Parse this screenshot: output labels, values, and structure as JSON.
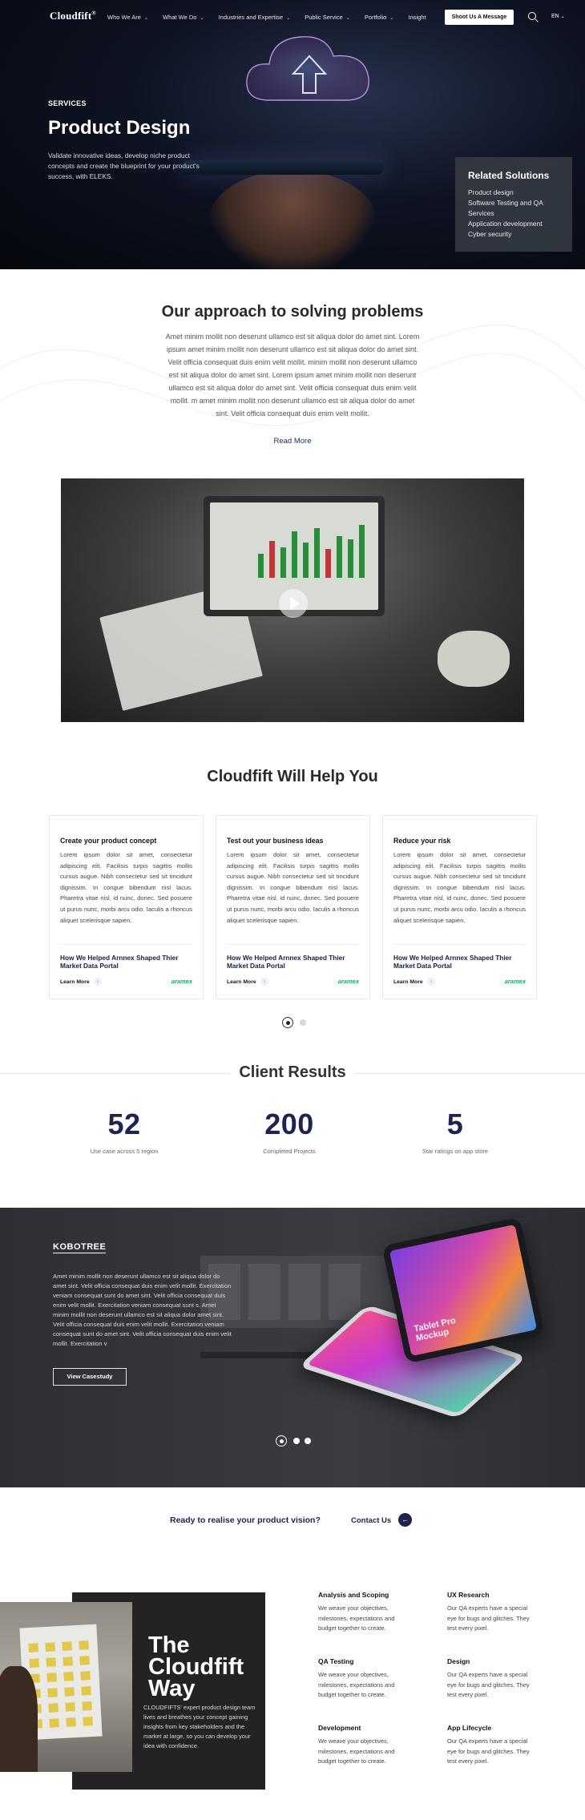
{
  "nav": {
    "logo": "Cloudfift",
    "logo_mark": "®",
    "items": [
      "Who We Are",
      "What We Do",
      "Industries and Expertise",
      "Public Service",
      "Portfolio",
      "Insight"
    ],
    "cta": "Shoot Us A Message",
    "lang": "EN",
    "icons": [
      "chevron-down-icon",
      "search-icon"
    ]
  },
  "hero": {
    "eyebrow": "SERVICES",
    "title": "Product Design",
    "description": "Validate innovative ideas, develop niche product concepts and create the blueprint for your product's success, with ELEKS.",
    "related_title": "Related Solutions",
    "related_items": [
      "Product design",
      "Software Testing and QA Services",
      "Application development",
      "Cyber security"
    ]
  },
  "approach": {
    "title": "Our approach to solving problems",
    "text": "Amet minim mollit non deserunt ullamco est sit aliqua dolor do amet sint. Lorem ipsum amet minim mollit non deserunt ullamco est sit aliqua dolor do amet sint. Velit officia consequat duis enim velit mollit. minim mollit non deserunt ullamco est sit aliqua dolor do amet sint. Lorem ipsum amet minim mollit non deserunt ullamco est sit aliqua dolor do amet sint. Velit officia consequat duis enim velit mollit. m amet minim mollit non deserunt ullamco est sit aliqua dolor do amet sint. Velit officia consequat duis enim velit mollit.",
    "read_more": "Read More"
  },
  "video": {
    "icon": "play-icon"
  },
  "help": {
    "title": "Cloudfift Will Help You",
    "cards": [
      {
        "title": "Create your product concept",
        "text": "Lorem ipsum dolor sit amet, consectetur adipiscing elit. Facilisis turpis sagittis mollis cursus augue. Nibh consectetur sed sit tincidunt dignissim. In congue bibendum nisl lacus. Pharetra vitae nisl, id nunc, donec. Sed posuere ut purus nunc, morbi arcu odio. Iaculis a rhoncus aliquet scelerisque sapien.",
        "case": "How We Helped Arnnex Shaped Thier Market Data Portal",
        "more": "Learn More",
        "brand": "aramex"
      },
      {
        "title": "Test out your business ideas",
        "text": "Lorem ipsum dolor sit amet, consectetur adipiscing elit. Facilisis turpis sagittis mollis cursus augue. Nibh consectetur sed sit tincidunt dignissim. In congue bibendum nisl lacus. Pharetra vitae nisl, id nunc, donec. Sed posuere ut purus nunc, morbi arcu odio. Iaculis a rhoncus aliquet scelerisque sapien.",
        "case": "How We Helped Arnnex Shaped Thier Market Data Portal",
        "more": "Learn More",
        "brand": "aramex"
      },
      {
        "title": "Reduce your risk",
        "text": "Lorem ipsum dolor sit amet, consectetur adipiscing elit. Facilisis turpis sagittis mollis cursus augue. Nibh consectetur sed sit tincidunt dignissim. In congue bibendum nisl lacus. Pharetra vitae nisl, id nunc, donec. Sed posuere ut purus nunc, morbi arcu odio. Iaculis a rhoncus aliquet scelerisque sapien.",
        "case": "How We Helped Arnnex Shaped Thier Market Data Portal",
        "more": "Learn More",
        "brand": "aramex"
      }
    ]
  },
  "results": {
    "title": "Client Results",
    "stats": [
      {
        "value": "52",
        "label": "Use case across 5 region"
      },
      {
        "value": "200",
        "label": "Completed Projects"
      },
      {
        "value": "5",
        "label": "Star ratings on app store"
      }
    ]
  },
  "kobotree": {
    "title": "KOBOTREE",
    "description": "Amet minim mollit non deserunt ullamco est sit aliqua dolor do amet sint. Velit officia consequat duis enim velit mollit. Exercitation veniam consequat sunt do amet sint. Velit officia consequat duis enim velit mollit. Exercitation veniam consequat sunt s. Amet minim mollit non deserunt ullamco est sit aliqua dolor amet sint. Velit officia consequat duis enim velit mollit. Exercitation veniam consequat sunt do amet sint. Velit officia consequat duis enim velit mollit. Exercitation v",
    "button": "View Casestudy",
    "mockup_label": "Tablet Pro Mockup"
  },
  "ready": {
    "text": "Ready to realise your product vision?",
    "contact": "Contact Us",
    "icon": "arrow-right-icon"
  },
  "way": {
    "title_lines": [
      "The",
      "Cloudfift",
      "Way"
    ],
    "description": "CLOUDFIFTS' expert product design team lives and breathes your concept gaining insights from key stakeholders and the market at large, so you can develop your idea with confidence.",
    "steps": [
      {
        "title": "Analysis and Scoping",
        "text": "We weave your objectives, milestones, expectations and budget together to create."
      },
      {
        "title": "UX Research",
        "text": "Our QA experts have a special eye for bugs and glitches. They test every pixel."
      },
      {
        "title": "QA Testing",
        "text": "We weave your objectives, milestones, expectations and budget together to create."
      },
      {
        "title": "Design",
        "text": "Our QA experts have a special eye for bugs and glitches. They test every pixel."
      },
      {
        "title": "Development",
        "text": "We weave your objectives, milestones, expectations and budget together to create."
      },
      {
        "title": "App Lifecycle",
        "text": "Our QA experts have a special eye for bugs and glitches. They test every pixel."
      }
    ]
  }
}
